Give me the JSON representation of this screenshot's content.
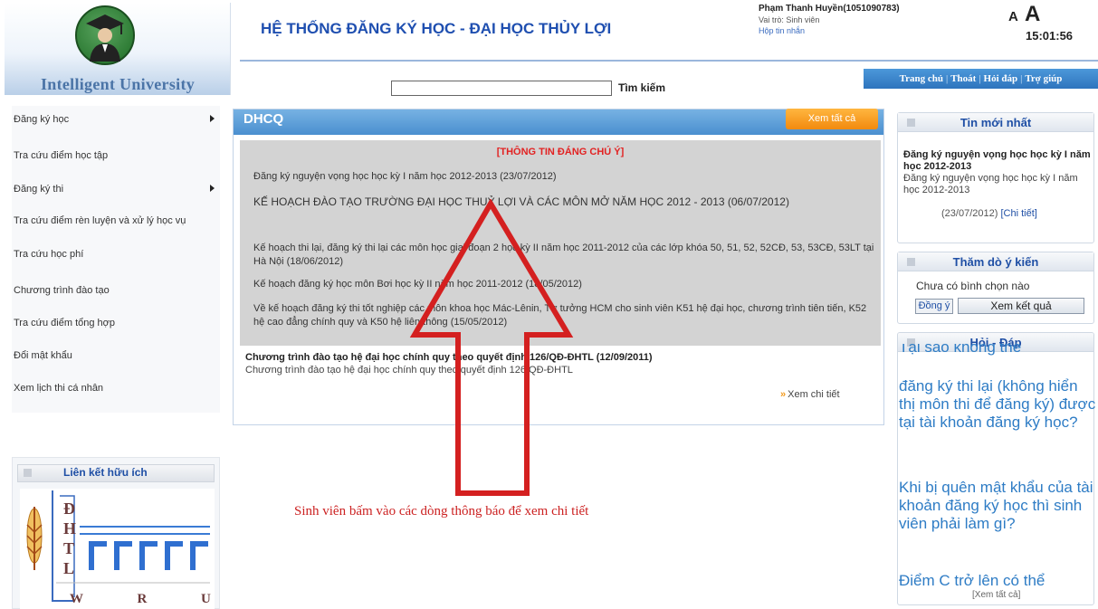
{
  "header": {
    "university_name": "Intelligent University",
    "system_title": "HỆ THỐNG ĐĂNG KÝ HỌC - ĐẠI HỌC THỦY LỢI",
    "user_name": "Phạm Thanh Huyền(1051090783)",
    "user_role": "Vai trò: Sinh viên",
    "inbox_link": "Hộp tin nhắn",
    "font_small": "A",
    "font_large": "A",
    "clock": "15:01:56",
    "search_placeholder": "",
    "search_label": "Tìm kiếm",
    "nav": [
      "Trang chủ",
      "Thoát",
      "Hỏi đáp",
      "Trợ giúp"
    ],
    "nav_separator": "|"
  },
  "left_menu": {
    "items": [
      {
        "label": "Đăng ký học",
        "has_submenu": true
      },
      {
        "label": "Tra cứu điểm học tập",
        "has_submenu": false
      },
      {
        "label": "Đăng ký thi",
        "has_submenu": true
      },
      {
        "label": "Tra cứu điểm rèn luyện và xử lý học vụ",
        "has_submenu": false
      },
      {
        "label": "Tra cứu học phí",
        "has_submenu": false
      },
      {
        "label": "Chương trình đào tạo",
        "has_submenu": false
      },
      {
        "label": "Tra cứu điểm tổng hợp",
        "has_submenu": false
      },
      {
        "label": "Đổi mật khẩu",
        "has_submenu": false
      },
      {
        "label": "Xem lịch thi cá nhân",
        "has_submenu": false
      }
    ],
    "links_title": "Liên kết hữu ích",
    "logo_letters": [
      "Đ",
      "H",
      "T",
      "L"
    ],
    "logo_footer": "W R U"
  },
  "main": {
    "panel_title": "DHCQ",
    "view_all": "Xem tất cả",
    "notice_heading": "[THÔNG TIN ĐÁNG CHÚ Ý]",
    "notices": [
      "Đăng ký nguyện vọng học học kỳ I năm học 2012-2013 (23/07/2012)",
      "KẾ HOẠCH ĐÀO TẠO TRƯỜNG ĐẠI HỌC THUỶ LỢI VÀ CÁC MÔN MỞ NĂM HỌC 2012 - 2013 (06/07/2012)",
      "Kế hoạch thi lại, đăng ký thi lại các môn học giai đoạn 2 học kỳ II năm học 2011-2012 của các lớp khóa 50, 51, 52, 52CĐ, 53, 53CĐ, 53LT tại Hà Nội (18/06/2012)",
      "Kế hoạch đăng ký học môn Bơi học kỳ II năm học 2011-2012 (18/05/2012)",
      "Về kế hoạch đăng ký thi tốt nghiệp các môn khoa học Mác-Lênin, Tư tưởng HCM cho sinh viên K51 hệ đại học, chương trình tiên tiến, K52 hệ cao đẳng chính quy và K50 hệ liên thông (15/05/2012)"
    ],
    "program_title": "Chương trình đào tạo hệ đại học chính quy theo quyết định 126/QĐ-ĐHTL (12/09/2011)",
    "program_desc": "Chương trình đào tạo hệ đại học chính quy theo quyết định 126/QĐ-ĐHTL",
    "details_link": "Xem chi tiết",
    "annotation": "Sinh viên bấm vào các dòng thông báo để xem chi tiết"
  },
  "right": {
    "news_title": "Tin mới nhất",
    "news_item_title": "Đăng ký nguyện vọng học học kỳ I năm học 2012-2013",
    "news_item_body": "Đăng ký nguyện vọng học học kỳ I năm học 2012-2013",
    "news_item_date": "(23/07/2012)",
    "news_item_more": "[Chi tiết]",
    "poll_title": "Thăm dò ý kiến",
    "poll_text": "Chưa có bình chọn nào",
    "poll_agree": "Đồng ý",
    "poll_results": "Xem kết quả",
    "qa_title": "Hỏi - Đáp",
    "qa_items": [
      "Tại sao không thể",
      "đăng ký thi lại (không hiển thị môn thi để đăng ký) được tại tài khoản đăng ký học?",
      "Khi bị quên mật khẩu của tài khoản đăng ký học thì sinh viên phải làm gì?",
      "Điểm C trở lên có thể"
    ],
    "qa_more": "[Xem tất cả]"
  },
  "colors": {
    "title_blue": "#1f4fb0",
    "panel_blue": "#4a8fcf",
    "orange": "#f28a0e",
    "red": "#e22222",
    "qa_blue": "#2e7cc5"
  }
}
